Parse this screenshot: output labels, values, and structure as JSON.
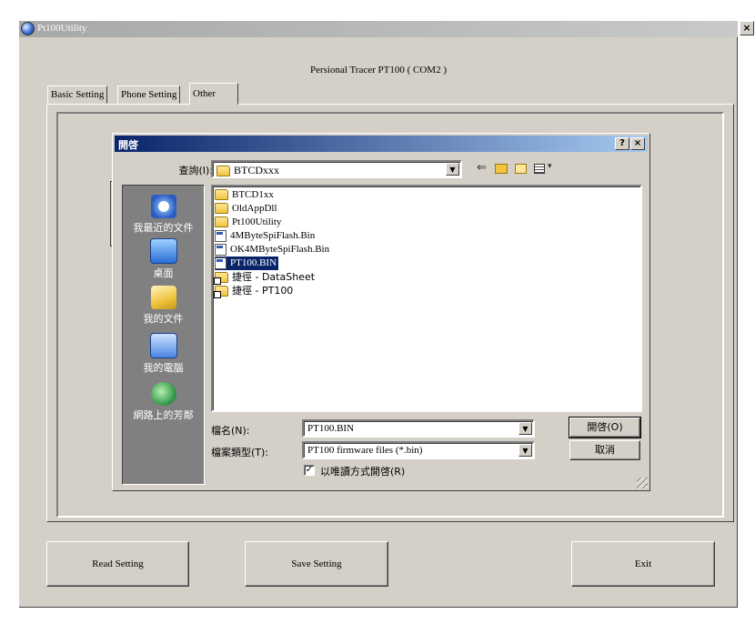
{
  "app": {
    "title": "Pt100Utility",
    "close_glyph": "×",
    "heading": "Persional Tracer PT100 ( COM2 )"
  },
  "tabs": [
    {
      "label": "Basic Setting"
    },
    {
      "label": "Phone Setting"
    },
    {
      "label": "Other"
    }
  ],
  "buttons": {
    "read": "Read Setting",
    "save": "Save Setting",
    "exit": "Exit"
  },
  "dialog": {
    "title": "開啓",
    "help_glyph": "?",
    "close_glyph": "×",
    "lookin_label": "查詢(I):",
    "lookin_value": "BTCDxxx",
    "places": [
      {
        "label": "我最近的文件",
        "icon": "recent-documents-icon"
      },
      {
        "label": "桌面",
        "icon": "desktop-icon"
      },
      {
        "label": "我的文件",
        "icon": "my-documents-icon"
      },
      {
        "label": "我的電腦",
        "icon": "my-computer-icon"
      },
      {
        "label": "網路上的芳鄰",
        "icon": "network-places-icon"
      }
    ],
    "files": [
      {
        "name": "BTCD1xx",
        "kind": "folder"
      },
      {
        "name": "OldAppDll",
        "kind": "folder"
      },
      {
        "name": "Pt100Utility",
        "kind": "folder"
      },
      {
        "name": "4MByteSpiFlash.Bin",
        "kind": "file"
      },
      {
        "name": "OK4MByteSpiFlash.Bin",
        "kind": "file"
      },
      {
        "name": "PT100.BIN",
        "kind": "file",
        "selected": true
      },
      {
        "name": "捷徑 - DataSheet",
        "kind": "shortcut"
      },
      {
        "name": "捷徑 - PT100",
        "kind": "shortcut"
      }
    ],
    "filename_label": "檔名(N):",
    "filename_value": "PT100.BIN",
    "filetype_label": "檔案類型(T):",
    "filetype_value": "PT100 firmware files (*.bin)",
    "readonly_label": "以唯讀方式開啓(R)",
    "readonly_checked_glyph": "✓",
    "open_button": "開啓(O)",
    "cancel_button": "取消"
  }
}
